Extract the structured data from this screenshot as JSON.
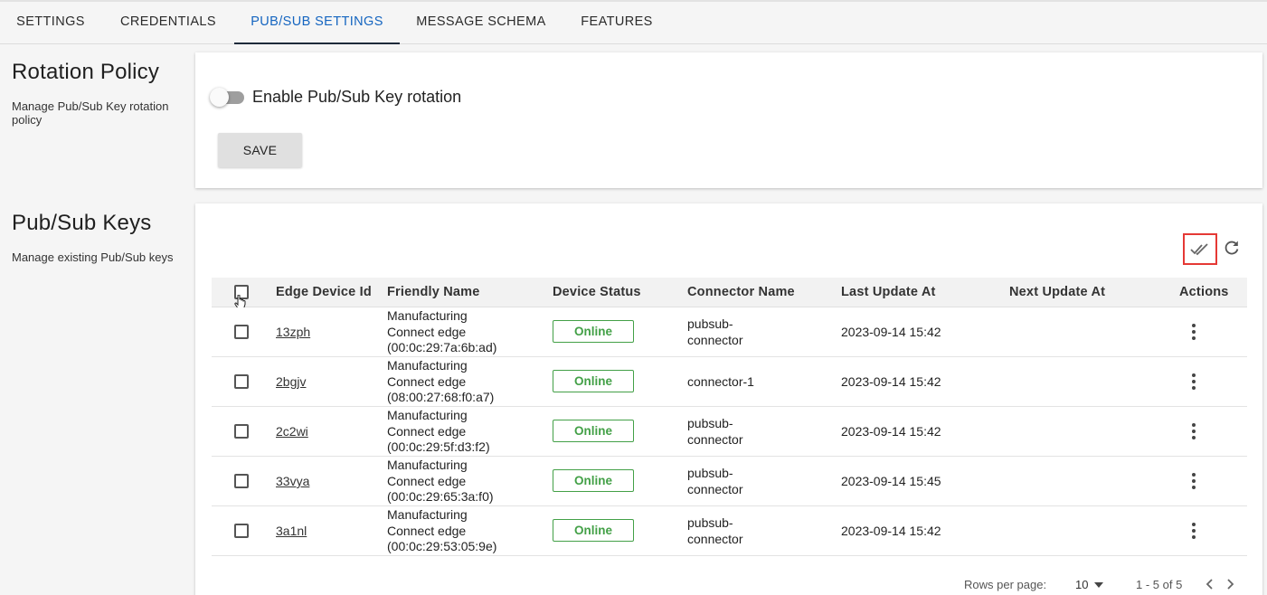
{
  "tabs": [
    {
      "label": "SETTINGS"
    },
    {
      "label": "CREDENTIALS"
    },
    {
      "label": "PUB/SUB SETTINGS"
    },
    {
      "label": "MESSAGE SCHEMA"
    },
    {
      "label": "FEATURES"
    }
  ],
  "active_tab": "PUB/SUB SETTINGS",
  "rotation": {
    "title": "Rotation Policy",
    "description": "Manage Pub/Sub Key rotation policy",
    "toggle_label": "Enable Pub/Sub Key rotation",
    "toggle_on": false,
    "save_label": "SAVE"
  },
  "keys": {
    "title": "Pub/Sub Keys",
    "description": "Manage existing Pub/Sub keys"
  },
  "toolbar": {
    "icons": [
      "double-check-icon",
      "refresh-icon"
    ]
  },
  "table": {
    "columns": [
      "Edge Device Id",
      "Friendly Name",
      "Device Status",
      "Connector Name",
      "Last Update At",
      "Next Update At",
      "Actions"
    ],
    "rows": [
      {
        "id": "13zph",
        "friendly": [
          "Manufacturing",
          "Connect edge",
          "(00:0c:29:7a:6b:ad)"
        ],
        "status": "Online",
        "connector": [
          "pubsub-",
          "connector"
        ],
        "last_update": "2023-09-14 15:42",
        "next_update": ""
      },
      {
        "id": "2bgjv",
        "friendly": [
          "Manufacturing",
          "Connect edge",
          "(08:00:27:68:f0:a7)"
        ],
        "status": "Online",
        "connector": [
          "connector-1"
        ],
        "last_update": "2023-09-14 15:42",
        "next_update": ""
      },
      {
        "id": "2c2wi",
        "friendly": [
          "Manufacturing",
          "Connect edge",
          "(00:0c:29:5f:d3:f2)"
        ],
        "status": "Online",
        "connector": [
          "pubsub-",
          "connector"
        ],
        "last_update": "2023-09-14 15:42",
        "next_update": ""
      },
      {
        "id": "33vya",
        "friendly": [
          "Manufacturing",
          "Connect edge",
          "(00:0c:29:65:3a:f0)"
        ],
        "status": "Online",
        "connector": [
          "pubsub-",
          "connector"
        ],
        "last_update": "2023-09-14 15:45",
        "next_update": ""
      },
      {
        "id": "3a1nl",
        "friendly": [
          "Manufacturing",
          "Connect edge",
          "(00:0c:29:53:05:9e)"
        ],
        "status": "Online",
        "connector": [
          "pubsub-",
          "connector"
        ],
        "last_update": "2023-09-14 15:42",
        "next_update": ""
      }
    ]
  },
  "pagination": {
    "rows_per_page_label": "Rows per page:",
    "rows_per_page": "10",
    "range": "1 - 5 of 5"
  },
  "colors": {
    "accent": "#1565c0",
    "online": "#43a047",
    "highlight": "#e53935"
  }
}
